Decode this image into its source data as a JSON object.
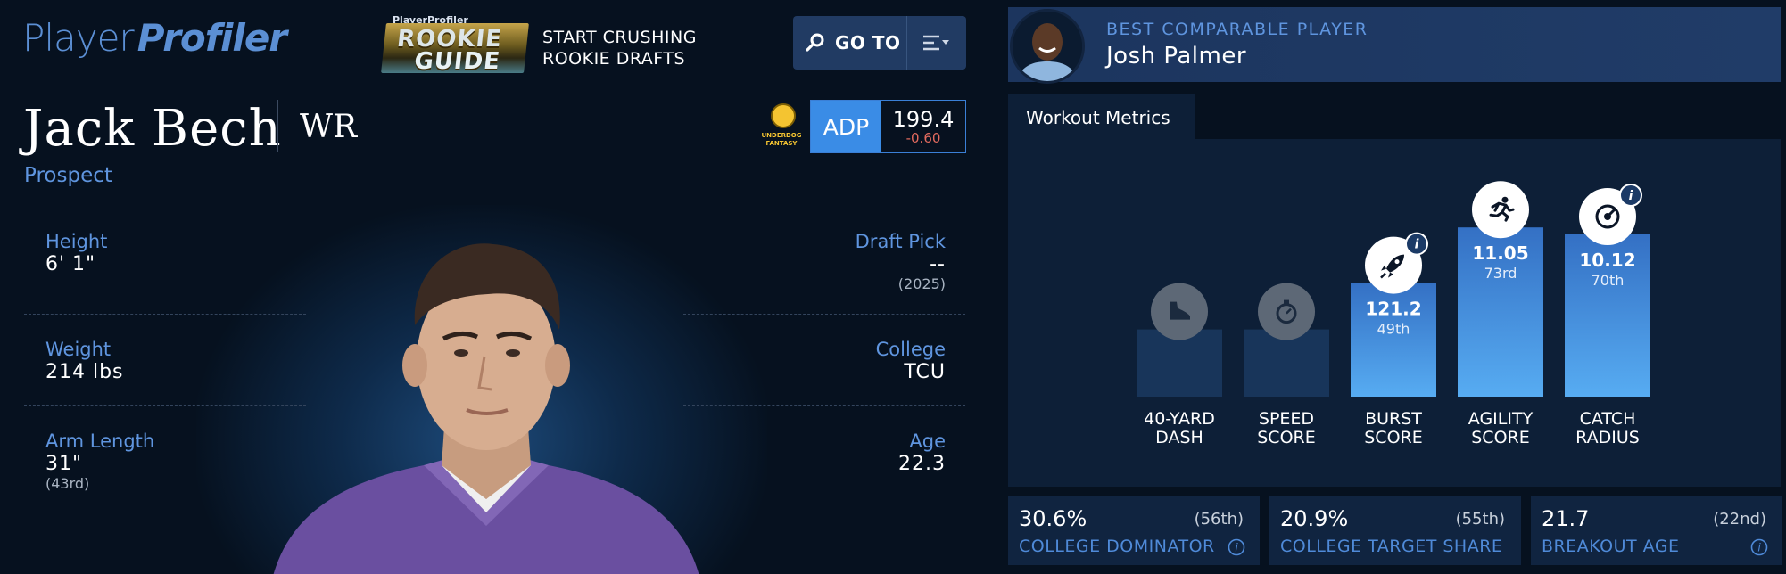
{
  "brand": {
    "part1": "Player",
    "part2": "Profiler"
  },
  "promo": {
    "badge_small": "PlayerProfiler",
    "badge_line1": "ROOKIE",
    "badge_line2": "GUIDE",
    "line1": "START CRUSHING",
    "line2": "ROOKIE DRAFTS"
  },
  "nav": {
    "goto_label": "GO TO"
  },
  "player": {
    "name": "Jack Bech",
    "position": "WR",
    "status": "Prospect"
  },
  "adp": {
    "source_line1": "UNDERDOG",
    "source_line2": "FANTASY",
    "label": "ADP",
    "value": "199.4",
    "change": "-0.60"
  },
  "stats": {
    "height": {
      "label": "Height",
      "value": "6' 1\""
    },
    "weight": {
      "label": "Weight",
      "value": "214 lbs"
    },
    "arm": {
      "label": "Arm Length",
      "value": "31\"",
      "sub": "(43rd)"
    },
    "draft": {
      "label": "Draft Pick",
      "value": "--",
      "sub": "(2025)"
    },
    "college": {
      "label": "College",
      "value": "TCU"
    },
    "age": {
      "label": "Age",
      "value": "22.3"
    }
  },
  "comparable": {
    "title": "BEST COMPARABLE PLAYER",
    "name": "Josh Palmer"
  },
  "workout": {
    "tab_label": "Workout Metrics",
    "metrics": [
      {
        "line1": "40-YARD",
        "line2": "DASH",
        "value": "",
        "rank": "",
        "icon": "shoe-icon",
        "bar_level": 0.29,
        "has_info": false
      },
      {
        "line1": "SPEED",
        "line2": "SCORE",
        "value": "",
        "rank": "",
        "icon": "stopwatch-icon",
        "bar_level": 0.29,
        "has_info": false
      },
      {
        "line1": "BURST",
        "line2": "SCORE",
        "value": "121.2",
        "rank": "49th",
        "icon": "rocket-icon",
        "bar_level": 0.49,
        "has_info": true
      },
      {
        "line1": "AGILITY",
        "line2": "SCORE",
        "value": "11.05",
        "rank": "73rd",
        "icon": "runner-icon",
        "bar_level": 0.73,
        "has_info": false
      },
      {
        "line1": "CATCH",
        "line2": "RADIUS",
        "value": "10.12",
        "rank": "70th",
        "icon": "target-icon",
        "bar_level": 0.7,
        "has_info": true
      }
    ],
    "colors": {
      "empty_bar": "#18355a",
      "filled_top": "#3470c4",
      "filled_bottom": "#57acf2"
    }
  },
  "college_metrics": [
    {
      "value": "30.6%",
      "rank": "(56th)",
      "label": "COLLEGE DOMINATOR"
    },
    {
      "value": "20.9%",
      "rank": "(55th)",
      "label": "COLLEGE TARGET SHARE"
    },
    {
      "value": "21.7",
      "rank": "(22nd)",
      "label": "BREAKOUT AGE"
    }
  ]
}
